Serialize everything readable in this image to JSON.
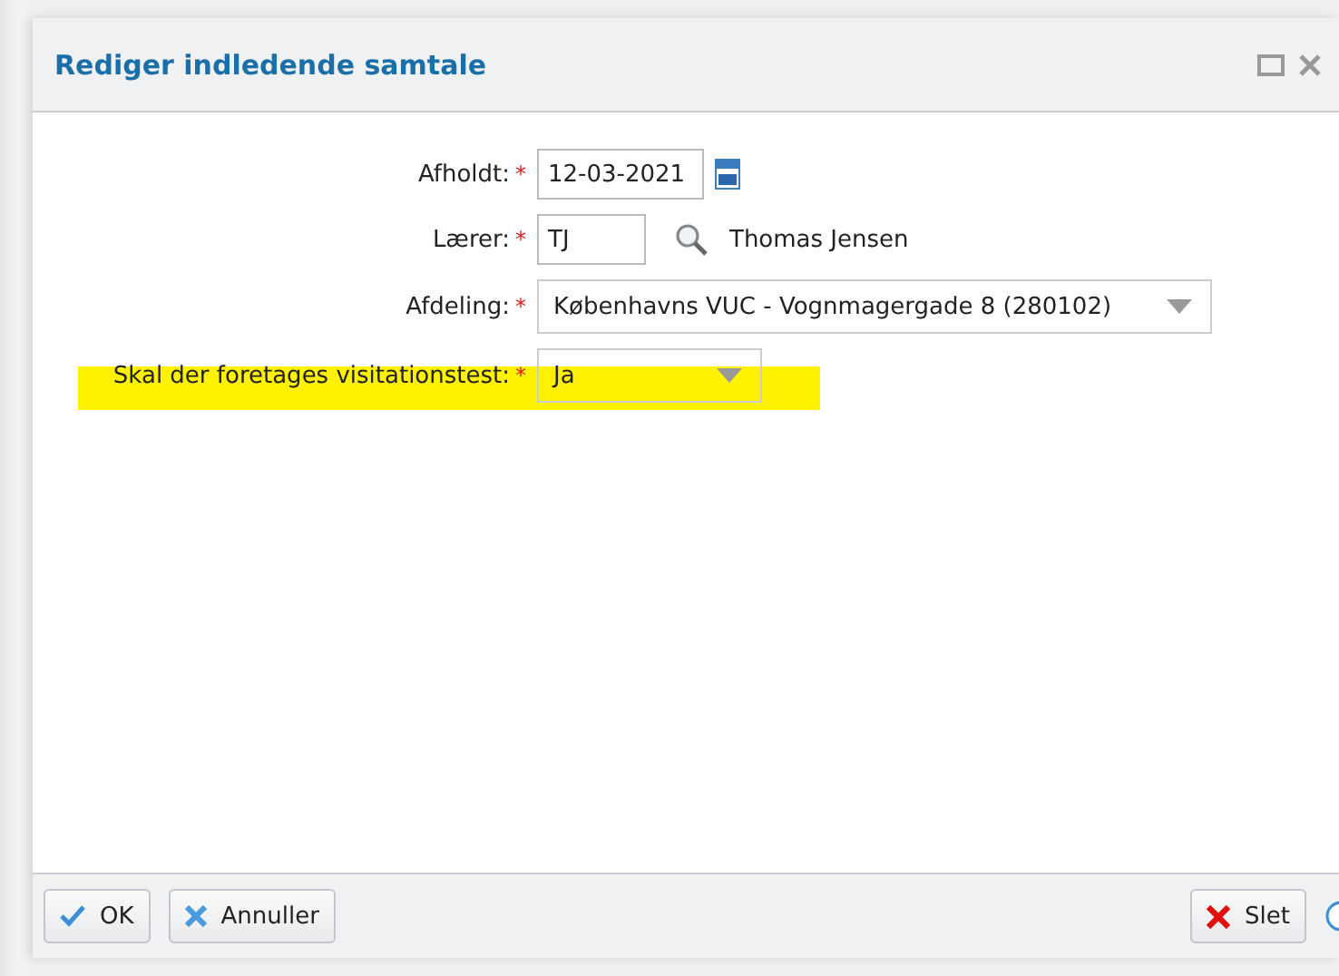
{
  "window": {
    "title": "Rediger indledende samtale"
  },
  "fields": [
    {
      "kind": "date",
      "label": "Afholdt:",
      "required_mark": "*",
      "value": "12-03-2021",
      "highlighted": false
    },
    {
      "kind": "lookup",
      "label": "Lærer:",
      "required_mark": "*",
      "value": "TJ",
      "resolved": "Thomas Jensen",
      "highlighted": false
    },
    {
      "kind": "select",
      "label": "Afdeling:",
      "required_mark": "*",
      "value": "Københavns VUC - Vognmagergade 8 (280102)",
      "highlighted": false
    },
    {
      "kind": "select",
      "label": "Skal der foretages visitationstest:",
      "required_mark": "*",
      "value": "Ja",
      "highlighted": true
    }
  ],
  "buttons": [
    {
      "kind": "ok",
      "label": "OK"
    },
    {
      "kind": "cancel",
      "label": "Annuller"
    },
    {
      "kind": "delete",
      "label": "Slet"
    }
  ]
}
